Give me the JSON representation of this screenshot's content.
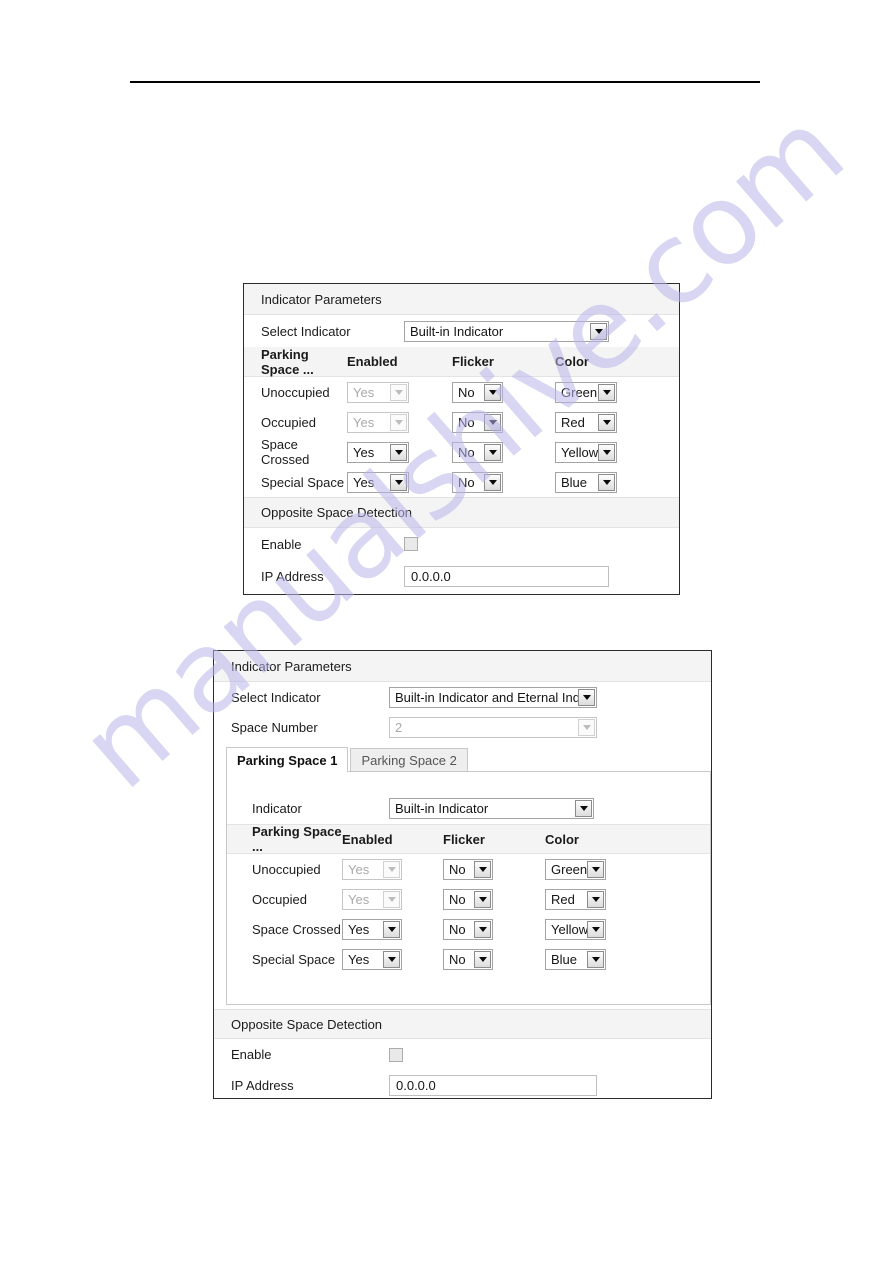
{
  "page": {
    "header_rule": true
  },
  "watermark": {
    "text": "manualshive.com"
  },
  "panel_one": {
    "section_title": "Indicator Parameters",
    "select_indicator": {
      "label": "Select Indicator",
      "value": "Built-in Indicator"
    },
    "table": {
      "headers": [
        "Parking Space ...",
        "Enabled",
        "Flicker",
        "Color"
      ],
      "rows": [
        {
          "name": "Unoccupied",
          "enabled": "Yes",
          "enabled_disabled": true,
          "flicker": "No",
          "color": "Green"
        },
        {
          "name": "Occupied",
          "enabled": "Yes",
          "enabled_disabled": true,
          "flicker": "No",
          "color": "Red"
        },
        {
          "name": "Space Crossed",
          "enabled": "Yes",
          "enabled_disabled": false,
          "flicker": "No",
          "color": "Yellow"
        },
        {
          "name": "Special Space",
          "enabled": "Yes",
          "enabled_disabled": false,
          "flicker": "No",
          "color": "Blue"
        }
      ]
    },
    "opposite": {
      "section_title": "Opposite Space Detection",
      "enable_label": "Enable",
      "enable_checked": false,
      "ip_label": "IP Address",
      "ip_value": "0.0.0.0"
    }
  },
  "panel_two": {
    "section_title": "Indicator Parameters",
    "select_indicator": {
      "label": "Select Indicator",
      "value": "Built-in Indicator and Eternal Indi"
    },
    "space_number": {
      "label": "Space Number",
      "value": "2"
    },
    "tabs": [
      {
        "label": "Parking Space 1",
        "active": true
      },
      {
        "label": "Parking Space 2",
        "active": false
      }
    ],
    "indicator": {
      "label": "Indicator",
      "value": "Built-in Indicator"
    },
    "table": {
      "headers": [
        "Parking Space ...",
        "Enabled",
        "Flicker",
        "Color"
      ],
      "rows": [
        {
          "name": "Unoccupied",
          "enabled": "Yes",
          "enabled_disabled": true,
          "flicker": "No",
          "color": "Green"
        },
        {
          "name": "Occupied",
          "enabled": "Yes",
          "enabled_disabled": true,
          "flicker": "No",
          "color": "Red"
        },
        {
          "name": "Space Crossed",
          "enabled": "Yes",
          "enabled_disabled": false,
          "flicker": "No",
          "color": "Yellow"
        },
        {
          "name": "Special Space",
          "enabled": "Yes",
          "enabled_disabled": false,
          "flicker": "No",
          "color": "Blue"
        }
      ]
    },
    "opposite": {
      "section_title": "Opposite Space Detection",
      "enable_label": "Enable",
      "enable_checked": false,
      "ip_label": "IP Address",
      "ip_value": "0.0.0.0"
    }
  },
  "colors": {
    "band": "#f4f4f4",
    "panel_border": "#2b2b2b",
    "watermark": "#b9b5e8"
  }
}
